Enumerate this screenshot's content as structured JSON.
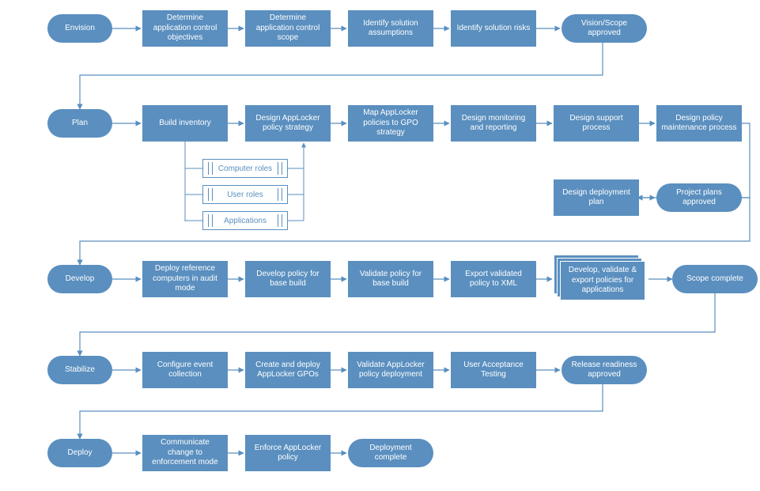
{
  "phases": {
    "envision": "Envision",
    "plan": "Plan",
    "develop": "Develop",
    "stabilize": "Stabilize",
    "deploy": "Deploy"
  },
  "envision": {
    "s1": "Determine application control objectives",
    "s2": "Determine application control scope",
    "s3": "Identify solution assumptions",
    "s4": "Identify solution risks",
    "milestone": "Vision/Scope approved"
  },
  "plan": {
    "s1": "Build inventory",
    "s2": "Design AppLocker policy strategy",
    "s3": "Map AppLocker policies to GPO strategy",
    "s4": "Design monitoring and reporting",
    "s5": "Design support process",
    "s6": "Design policy maintenance process",
    "s7": "Design deployment plan",
    "milestone": "Project plans approved",
    "sub1": "Computer roles",
    "sub2": "User roles",
    "sub3": "Applications"
  },
  "develop": {
    "s1": "Deploy reference computers in audit mode",
    "s2": "Develop policy for base build",
    "s3": "Validate policy for base build",
    "s4": "Export validated policy to XML",
    "stack": "Develop, validate & export policies for applications",
    "milestone": "Scope complete"
  },
  "stabilize": {
    "s1": "Configure event collection",
    "s2": "Create and deploy AppLocker GPOs",
    "s3": "Validate AppLocker policy deployment",
    "s4": "User Acceptance Testing",
    "milestone": "Release readiness approved"
  },
  "deploy": {
    "s1": "Communicate change to enforcement mode",
    "s2": "Enforce AppLocker policy",
    "milestone": "Deployment complete"
  }
}
